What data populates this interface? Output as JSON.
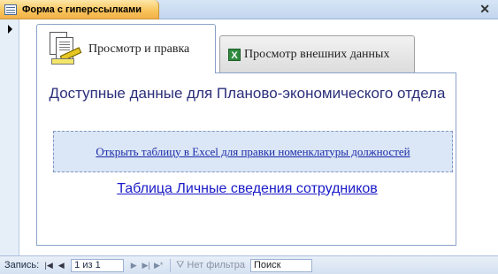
{
  "document": {
    "tab_title": "Форма с гиперссылками",
    "close_symbol": "✕"
  },
  "tabs": [
    {
      "label": "Просмотр и правка",
      "icon": "document-edit-icon",
      "active": true
    },
    {
      "label": "Просмотр внешних данных",
      "icon": "excel-icon",
      "icon_glyph": "X",
      "active": false
    }
  ],
  "page": {
    "heading": "Доступные данные для Планово-экономического отдела",
    "excel_link": "Открыть таблицу в Excel для правки номенклатуры должностей",
    "table_link": " Таблица Личные сведения сотрудников"
  },
  "navbar": {
    "record_label": "Запись:",
    "position": "1 из 1",
    "filter_label": "Нет фильтра",
    "search_value": "Поиск"
  },
  "colors": {
    "doc_tab": "#f8c35a",
    "heading": "#2b2f7a",
    "link": "#1a2aa8",
    "link_box": "#dbe6f6"
  }
}
